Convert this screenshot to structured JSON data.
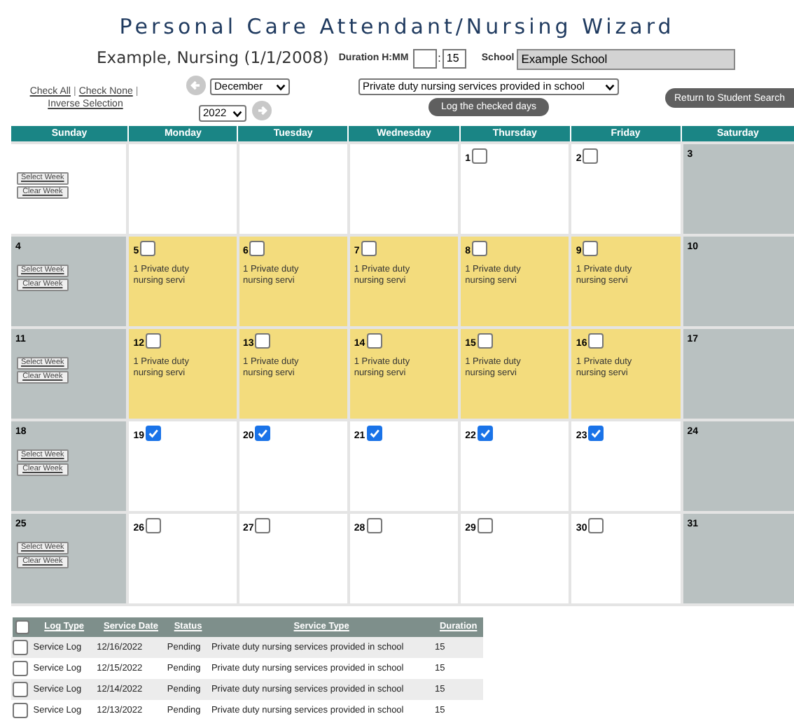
{
  "title": "Personal Care Attendant/Nursing Wizard",
  "student": "Example, Nursing (1/1/2008)",
  "duration": {
    "label": "Duration H:MM",
    "separator": ":",
    "minutes": "15"
  },
  "school": {
    "label": "School",
    "value": "Example School"
  },
  "selection_links": [
    "Check All",
    "Check None",
    "Inverse Selection"
  ],
  "link_separator": "|",
  "month_select": "December",
  "year_select": "2022",
  "service_select": "Private duty nursing services provided in school",
  "log_button": "Log the checked days",
  "return_button": "Return to Student Search",
  "calendar": {
    "weekdays": [
      "Sunday",
      "Monday",
      "Tuesday",
      "Wednesday",
      "Thursday",
      "Friday",
      "Saturday"
    ],
    "weeks": [
      {
        "buttons": [
          "Select Week",
          "Clear Week"
        ],
        "days": [
          {
            "kind": "blank"
          },
          {
            "kind": "blank"
          },
          {
            "kind": "blank"
          },
          {
            "kind": "blank"
          },
          {
            "kind": "weekday",
            "day": "1",
            "checked": false,
            "logged": false
          },
          {
            "kind": "weekday",
            "day": "2",
            "checked": false,
            "logged": false
          },
          {
            "kind": "weekend",
            "day": "3"
          }
        ]
      },
      {
        "buttons": [
          "Select Week",
          "Clear Week"
        ],
        "days": [
          {
            "kind": "weekend",
            "day": "4"
          },
          {
            "kind": "weekday",
            "day": "5",
            "checked": false,
            "logged": true,
            "entry": "1 Private duty nursing servi"
          },
          {
            "kind": "weekday",
            "day": "6",
            "checked": false,
            "logged": true,
            "entry": "1 Private duty nursing servi"
          },
          {
            "kind": "weekday",
            "day": "7",
            "checked": false,
            "logged": true,
            "entry": "1 Private duty nursing servi"
          },
          {
            "kind": "weekday",
            "day": "8",
            "checked": false,
            "logged": true,
            "entry": "1 Private duty nursing servi"
          },
          {
            "kind": "weekday",
            "day": "9",
            "checked": false,
            "logged": true,
            "entry": "1 Private duty nursing servi"
          },
          {
            "kind": "weekend",
            "day": "10"
          }
        ]
      },
      {
        "buttons": [
          "Select Week",
          "Clear Week"
        ],
        "days": [
          {
            "kind": "weekend",
            "day": "11"
          },
          {
            "kind": "weekday",
            "day": "12",
            "checked": false,
            "logged": true,
            "entry": "1 Private duty nursing servi"
          },
          {
            "kind": "weekday",
            "day": "13",
            "checked": false,
            "logged": true,
            "entry": "1 Private duty nursing servi"
          },
          {
            "kind": "weekday",
            "day": "14",
            "checked": false,
            "logged": true,
            "entry": "1 Private duty nursing servi"
          },
          {
            "kind": "weekday",
            "day": "15",
            "checked": false,
            "logged": true,
            "entry": "1 Private duty nursing servi"
          },
          {
            "kind": "weekday",
            "day": "16",
            "checked": false,
            "logged": true,
            "entry": "1 Private duty nursing servi"
          },
          {
            "kind": "weekend",
            "day": "17"
          }
        ]
      },
      {
        "buttons": [
          "Select Week",
          "Clear Week"
        ],
        "days": [
          {
            "kind": "weekend",
            "day": "18"
          },
          {
            "kind": "weekday",
            "day": "19",
            "checked": true,
            "logged": false
          },
          {
            "kind": "weekday",
            "day": "20",
            "checked": true,
            "logged": false
          },
          {
            "kind": "weekday",
            "day": "21",
            "checked": true,
            "logged": false
          },
          {
            "kind": "weekday",
            "day": "22",
            "checked": true,
            "logged": false
          },
          {
            "kind": "weekday",
            "day": "23",
            "checked": true,
            "logged": false
          },
          {
            "kind": "weekend",
            "day": "24"
          }
        ]
      },
      {
        "buttons": [
          "Select Week",
          "Clear Week"
        ],
        "days": [
          {
            "kind": "weekend",
            "day": "25"
          },
          {
            "kind": "weekday",
            "day": "26",
            "checked": false,
            "logged": false
          },
          {
            "kind": "weekday",
            "day": "27",
            "checked": false,
            "logged": false
          },
          {
            "kind": "weekday",
            "day": "28",
            "checked": false,
            "logged": false
          },
          {
            "kind": "weekday",
            "day": "29",
            "checked": false,
            "logged": false
          },
          {
            "kind": "weekday",
            "day": "30",
            "checked": false,
            "logged": false
          },
          {
            "kind": "weekend",
            "day": "31"
          }
        ]
      }
    ]
  },
  "log_table": {
    "select_all_checked": false,
    "columns": [
      "Log Type",
      "Service Date",
      "Status",
      "Service Type",
      "Duration"
    ],
    "rows": [
      {
        "checked": false,
        "cells": [
          "Service Log",
          "12/16/2022",
          "Pending",
          "Private duty nursing services provided in school",
          "15"
        ]
      },
      {
        "checked": false,
        "cells": [
          "Service Log",
          "12/15/2022",
          "Pending",
          "Private duty nursing services provided in school",
          "15"
        ]
      },
      {
        "checked": false,
        "cells": [
          "Service Log",
          "12/14/2022",
          "Pending",
          "Private duty nursing services provided in school",
          "15"
        ]
      },
      {
        "checked": false,
        "cells": [
          "Service Log",
          "12/13/2022",
          "Pending",
          "Private duty nursing services provided in school",
          "15"
        ]
      }
    ]
  }
}
